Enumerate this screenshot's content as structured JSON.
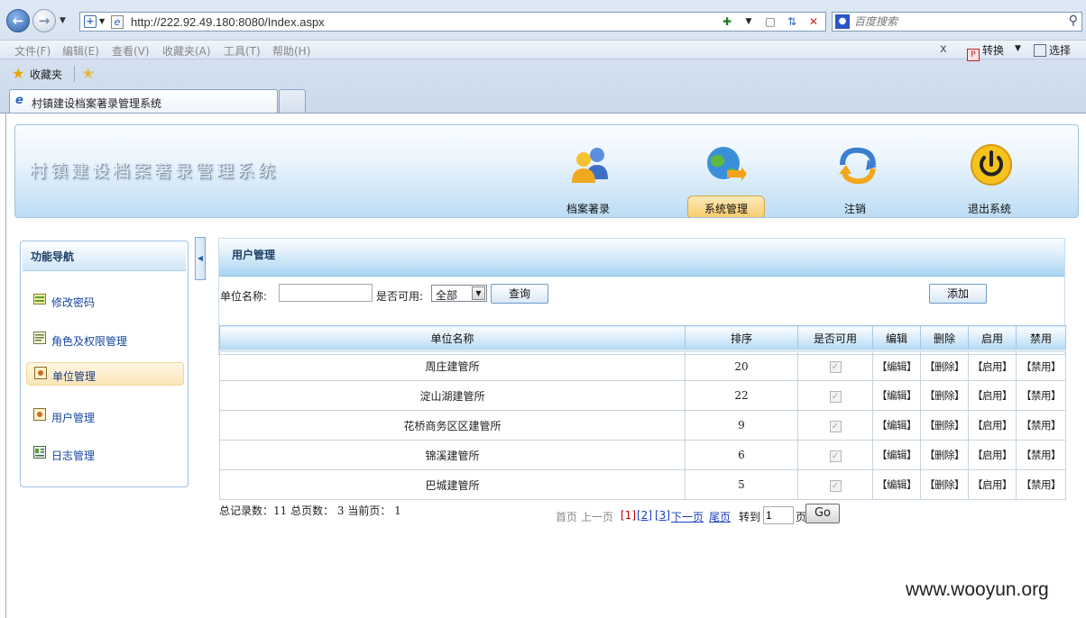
{
  "browser": {
    "url": "http://222.92.49.180:8080/Index.aspx",
    "search_placeholder": "百度搜索",
    "menu": [
      "文件(F)",
      "编辑(E)",
      "查看(V)",
      "收藏夹(A)",
      "工具(T)",
      "帮助(H)"
    ],
    "close_label": "x",
    "convert_label": "转换",
    "select_label": "选择",
    "favorites_label": "收藏夹",
    "tab_title": "村镇建设档案著录管理系统"
  },
  "banner": {
    "title": "村镇建设档案著录管理系统",
    "nav": [
      {
        "label": "档案著录",
        "icon": "users-icon"
      },
      {
        "label": "系统管理",
        "icon": "globe-manage-icon"
      },
      {
        "label": "注销",
        "icon": "logout-arrow-icon"
      },
      {
        "label": "退出系统",
        "icon": "power-icon"
      }
    ],
    "active_nav": "系统管理"
  },
  "sidebar": {
    "title": "功能导航",
    "items": [
      {
        "label": "修改密码",
        "icon": "password-icon"
      },
      {
        "label": "角色及权限管理",
        "icon": "role-icon"
      },
      {
        "label": "单位管理",
        "icon": "unit-icon"
      },
      {
        "label": "用户管理",
        "icon": "user-icon"
      },
      {
        "label": "日志管理",
        "icon": "log-icon"
      }
    ],
    "active_item": "单位管理"
  },
  "panel": {
    "title": "用户管理",
    "unit_name_label": "单位名称:",
    "unit_name_value": "",
    "enabled_label": "是否可用:",
    "enabled_value": "全部",
    "query_label": "查询",
    "add_label": "添加"
  },
  "table": {
    "columns": [
      "单位名称",
      "排序",
      "是否可用",
      "编辑",
      "删除",
      "启用",
      "禁用"
    ],
    "rows": [
      {
        "name": "周庄建管所",
        "order": "20",
        "enabled": true,
        "edit": "【编辑】",
        "delete": "【删除】",
        "enable": "【启用】",
        "disable": "【禁用】"
      },
      {
        "name": "淀山湖建管所",
        "order": "22",
        "enabled": true,
        "edit": "【编辑】",
        "delete": "【删除】",
        "enable": "【启用】",
        "disable": "【禁用】"
      },
      {
        "name": "花桥商务区区建管所",
        "order": "9",
        "enabled": true,
        "edit": "【编辑】",
        "delete": "【删除】",
        "enable": "【启用】",
        "disable": "【禁用】"
      },
      {
        "name": "锦溪建管所",
        "order": "6",
        "enabled": true,
        "edit": "【编辑】",
        "delete": "【删除】",
        "enable": "【启用】",
        "disable": "【禁用】"
      },
      {
        "name": "巴城建管所",
        "order": "5",
        "enabled": true,
        "edit": "【编辑】",
        "delete": "【删除】",
        "enable": "【启用】",
        "disable": "【禁用】"
      }
    ]
  },
  "summary": {
    "text": "总记录数：11 总页数：  3 当前页：  1"
  },
  "pager": {
    "first": "首页",
    "prev": "上一页",
    "pages": [
      "[1]",
      "[2]",
      "[3]"
    ],
    "next": "下一页",
    "last": "尾页",
    "goto_label": "转到",
    "goto_value": "1",
    "page_suffix": "页",
    "go_label": "Go"
  },
  "watermark": "www.wooyun.org"
}
